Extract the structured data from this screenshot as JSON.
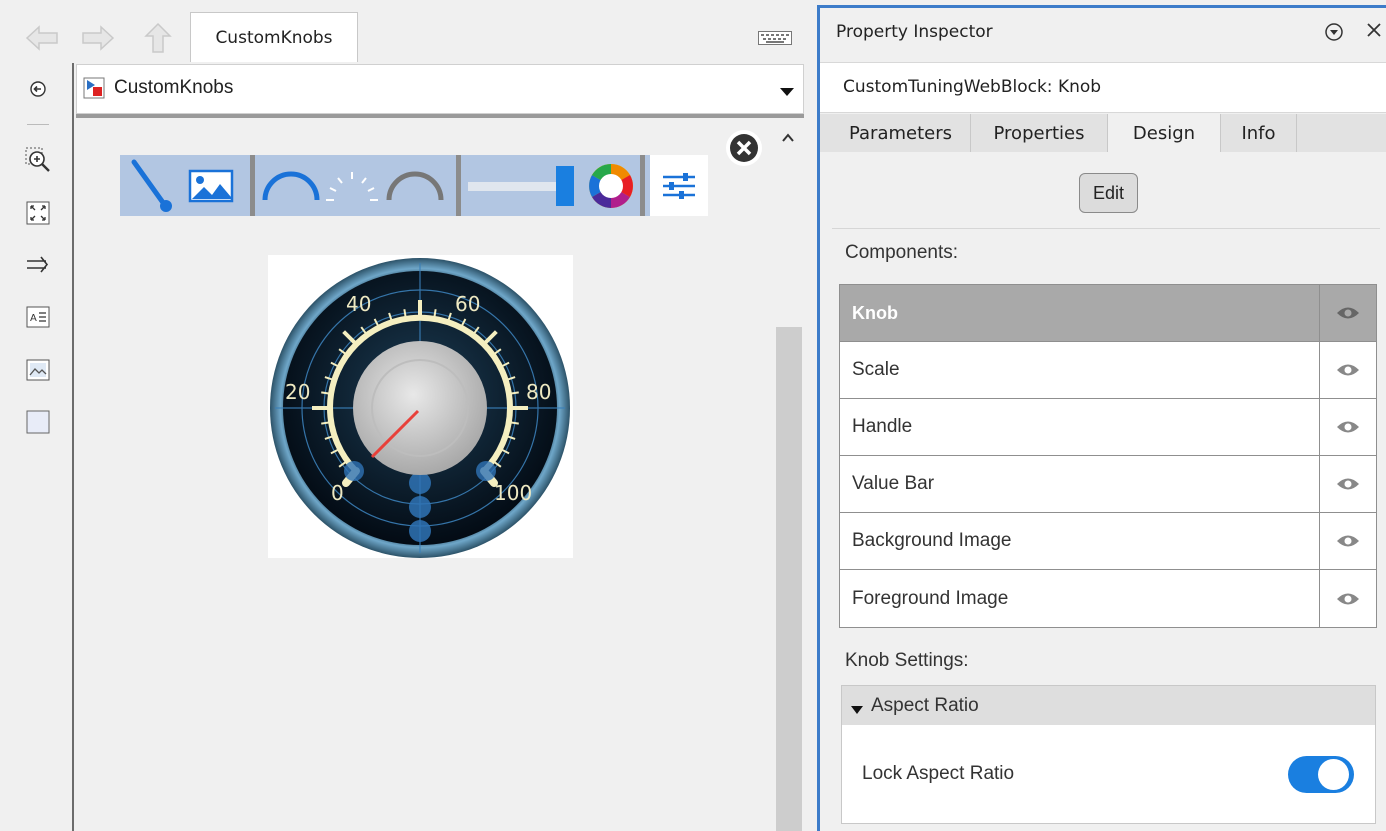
{
  "top_nav": {
    "tab_label": "CustomKnobs"
  },
  "address_bar": {
    "path": "CustomKnobs"
  },
  "left_toolbar": {
    "tools": [
      "back-icon",
      "zoom-in-icon",
      "fit-view-icon",
      "arrow-connect-icon",
      "annotation-icon",
      "image-icon",
      "area-icon"
    ]
  },
  "mask_toolbar": {
    "items": [
      "needle-icon",
      "image-icon",
      "arc-icon",
      "scale-ticks-icon",
      "range-icon",
      "slider-icon",
      "color-wheel-icon",
      "settings-icon"
    ]
  },
  "gauge": {
    "labels": [
      "0",
      "20",
      "40",
      "60",
      "80",
      "100"
    ]
  },
  "property_inspector": {
    "title": "Property Inspector",
    "block_name": "CustomTuningWebBlock: Knob",
    "tabs": [
      {
        "label": "Parameters"
      },
      {
        "label": "Properties"
      },
      {
        "label": "Design"
      },
      {
        "label": "Info"
      }
    ],
    "active_tab": "Design",
    "edit_label": "Edit",
    "components_label": "Components:",
    "components": [
      {
        "name": "Knob",
        "selected": true
      },
      {
        "name": "Scale",
        "selected": false
      },
      {
        "name": "Handle",
        "selected": false
      },
      {
        "name": "Value Bar",
        "selected": false
      },
      {
        "name": "Background Image",
        "selected": false
      },
      {
        "name": "Foreground Image",
        "selected": false
      }
    ],
    "settings_label": "Knob Settings:",
    "section_title": "Aspect Ratio",
    "lock_label": "Lock Aspect Ratio",
    "lock_value": true
  },
  "colors": {
    "accent": "#3d7cc9",
    "toggle_on": "#1a7fe0",
    "toolbar_bg": "#b2c6e2"
  }
}
